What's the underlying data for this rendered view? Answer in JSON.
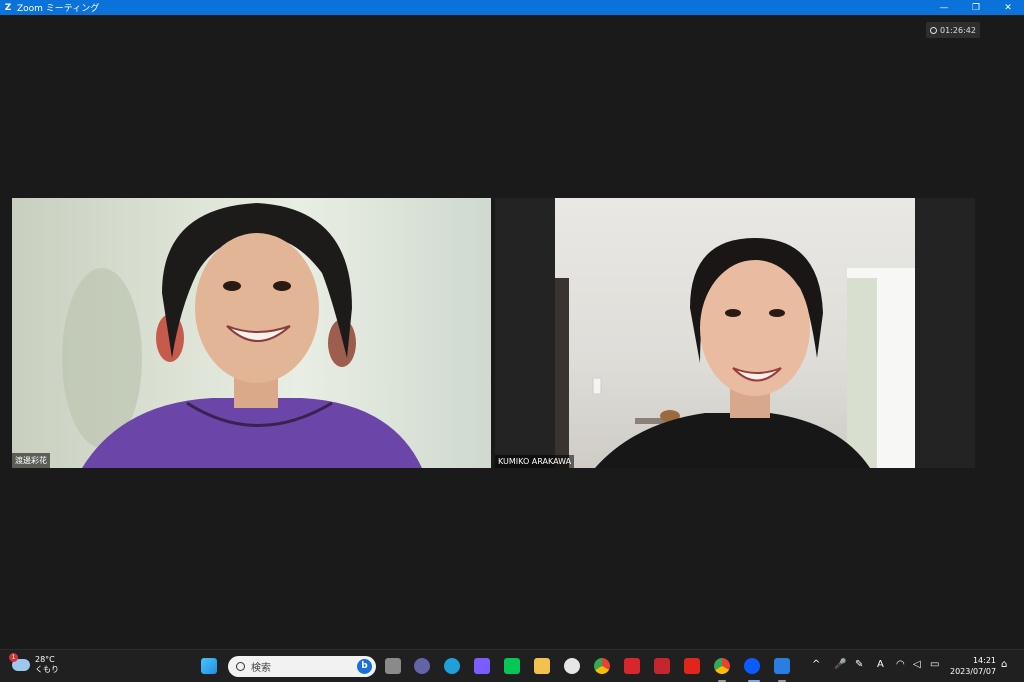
{
  "window": {
    "title": "Zoom ミーティング",
    "logo": "Z",
    "minimize": "—",
    "restore": "❐",
    "close": "✕"
  },
  "meeting": {
    "timer": "01:26:42",
    "participants": [
      {
        "name": "渡邊彩花"
      },
      {
        "name": "KUMIKO ARAKAWA"
      }
    ]
  },
  "taskbar": {
    "weather": {
      "temp": "28°C",
      "condition": "くもり",
      "badge": "1"
    },
    "search_placeholder": "検索",
    "bing": "b",
    "clock": {
      "time": "14:21",
      "date": "2023/07/07"
    },
    "icons": [
      {
        "name": "start-icon",
        "color": "#4cc2ff"
      },
      {
        "name": "task-view-icon",
        "color": "#8a8a8a"
      },
      {
        "name": "teams-chat-icon",
        "color": "#6264a7"
      },
      {
        "name": "edge-icon",
        "color": "#1fa0d8"
      },
      {
        "name": "copilot-icon",
        "color": "#7b5cff"
      },
      {
        "name": "line-icon",
        "color": "#06c755"
      },
      {
        "name": "file-explorer-icon",
        "color": "#f2c14e"
      },
      {
        "name": "whatsapp-icon",
        "color": "#e6e6e6"
      },
      {
        "name": "chrome-icon",
        "color": "#e94235"
      },
      {
        "name": "pdf-icon",
        "color": "#d8262d"
      },
      {
        "name": "pdf-tool-icon",
        "color": "#c4262e"
      },
      {
        "name": "acrobat-icon",
        "color": "#e1251b"
      },
      {
        "name": "chrome-profile-icon",
        "color": "#fbbc04"
      },
      {
        "name": "zoom-icon",
        "color": "#0b5cff"
      },
      {
        "name": "mail-icon",
        "color": "#2a7de1"
      }
    ]
  }
}
